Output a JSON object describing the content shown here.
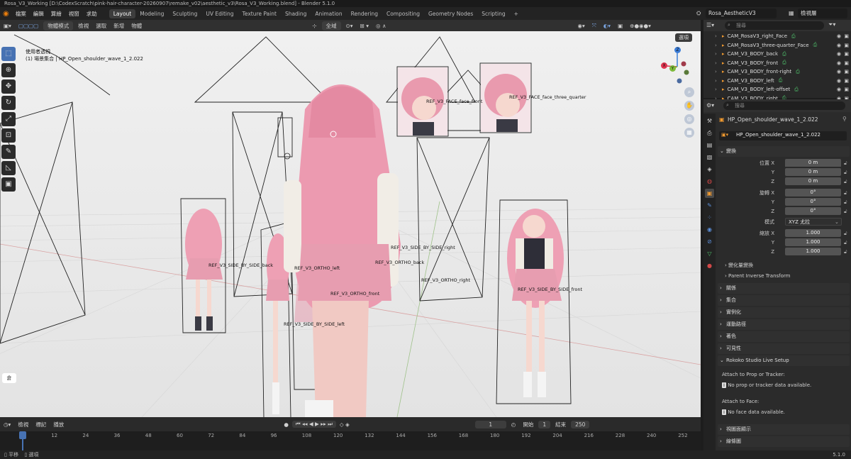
{
  "window": {
    "title": "Rosa_V3_Working [D:\\CodexScratch\\pink-hair-character-20260907\\remake_v02\\aesthetic_v3\\Rosa_V3_Working.blend] - Blender 5.1.0"
  },
  "topbar": {
    "menus": [
      "檔案",
      "編輯",
      "算繪",
      "視窗",
      "求助"
    ],
    "workspaces": [
      "Layout",
      "Modeling",
      "Sculpting",
      "UV Editing",
      "Texture Paint",
      "Shading",
      "Animation",
      "Rendering",
      "Compositing",
      "Geometry Nodes",
      "Scripting"
    ],
    "active_workspace": "Layout",
    "add_tab": "+",
    "scene": "Rosa_AestheticV3",
    "view_layer": "檢視層"
  },
  "viewport_header": {
    "mode": "物體模式",
    "menus": [
      "檢視",
      "選取",
      "新增",
      "物體"
    ],
    "orientation": "全域",
    "options": "選項"
  },
  "viewport": {
    "overlay_line1": "使用者透視",
    "overlay_line2": "(1) 場景集合 | HP_Open_shoulder_wave_1_2.022",
    "camera_labels": [
      {
        "id": "face-front",
        "text": "REF_V3_FACE_face_front"
      },
      {
        "id": "face-3q",
        "text": "REF_V3_FACE_face_three_quarter"
      },
      {
        "id": "sbs-right",
        "text": "REF_V3_SIDE_BY_SIDE_right"
      },
      {
        "id": "sbs-back",
        "text": "REF_V3_SIDE_BY_SIDE_back"
      },
      {
        "id": "ortho-left",
        "text": "REF_V3_ORTHO_left"
      },
      {
        "id": "ortho-back",
        "text": "REF_V3_ORTHO_back"
      },
      {
        "id": "ortho-right",
        "text": "REF_V3_ORTHO_right"
      },
      {
        "id": "ortho-front",
        "text": "REF_V3_ORTHO_front"
      },
      {
        "id": "sbs-front",
        "text": "REF_V3_SIDE_BY_SIDE_front"
      },
      {
        "id": "sbs-left",
        "text": "REF_V3_SIDE_BY_SIDE_left"
      }
    ],
    "gizmo": {
      "x": "X",
      "y": "Y",
      "z": "Z",
      "x_color": "#e0344f",
      "y_color": "#7dba3a",
      "z_color": "#3b7dd8"
    },
    "corner_glyph": "倉"
  },
  "timeline_header": {
    "menus": [
      "檢視",
      "標記",
      "播放"
    ],
    "current_frame": "1",
    "start_label": "開始",
    "start": "1",
    "end_label": "結束",
    "end": "250"
  },
  "timeline": {
    "ticks": [
      "1",
      "12",
      "24",
      "36",
      "48",
      "60",
      "72",
      "84",
      "96",
      "108",
      "120",
      "132",
      "144",
      "156",
      "168",
      "180",
      "192",
      "204",
      "216",
      "228",
      "240",
      "252"
    ]
  },
  "statusbar": {
    "left1": "平移",
    "left2": "選項",
    "version": "5.1.0"
  },
  "outliner": {
    "search_placeholder": "搜尋",
    "items": [
      "CAM_RosaV3_right_Face",
      "CAM_RosaV3_three-quarter_Face",
      "CAM_V3_BODY_back",
      "CAM_V3_BODY_front",
      "CAM_V3_BODY_front-right",
      "CAM_V3_BODY_left",
      "CAM_V3_BODY_left-offset",
      "CAM_V3_BODY_right"
    ]
  },
  "properties": {
    "search_placeholder": "搜尋",
    "object_name": "HP_Open_shoulder_wave_1_2.022",
    "object_field": "HP_Open_shoulder_wave_1_2.022",
    "transform": {
      "header": "變換",
      "location_label": "位置 X",
      "loc_y_label": "Y",
      "loc_z_label": "Z",
      "loc": [
        "0 m",
        "0 m",
        "0 m"
      ],
      "rotation_label": "旋轉 X",
      "rot_y_label": "Y",
      "rot_z_label": "Z",
      "rot": [
        "0°",
        "0°",
        "0°"
      ],
      "mode_label": "模式",
      "mode_value": "XYZ 尤拉",
      "scale_label": "縮放 X",
      "scale_y_label": "Y",
      "scale_z_label": "Z",
      "scale": [
        "1.000",
        "1.000",
        "1.000"
      ],
      "delta": "變化量變換",
      "parent_inverse": "Parent Inverse Transform"
    },
    "panels": [
      "關係",
      "集合",
      "實例化",
      "運動路徑",
      "著色",
      "可見性"
    ],
    "rokoko": {
      "header": "Rokoko Studio Live Setup",
      "attach_prop": "Attach to Prop or Tracker:",
      "no_prop": "No prop or tracker data available.",
      "attach_face": "Attach to Face:",
      "no_face": "No face data available."
    },
    "bottom_panels": [
      "視圖面顯示",
      "線條圖"
    ]
  }
}
